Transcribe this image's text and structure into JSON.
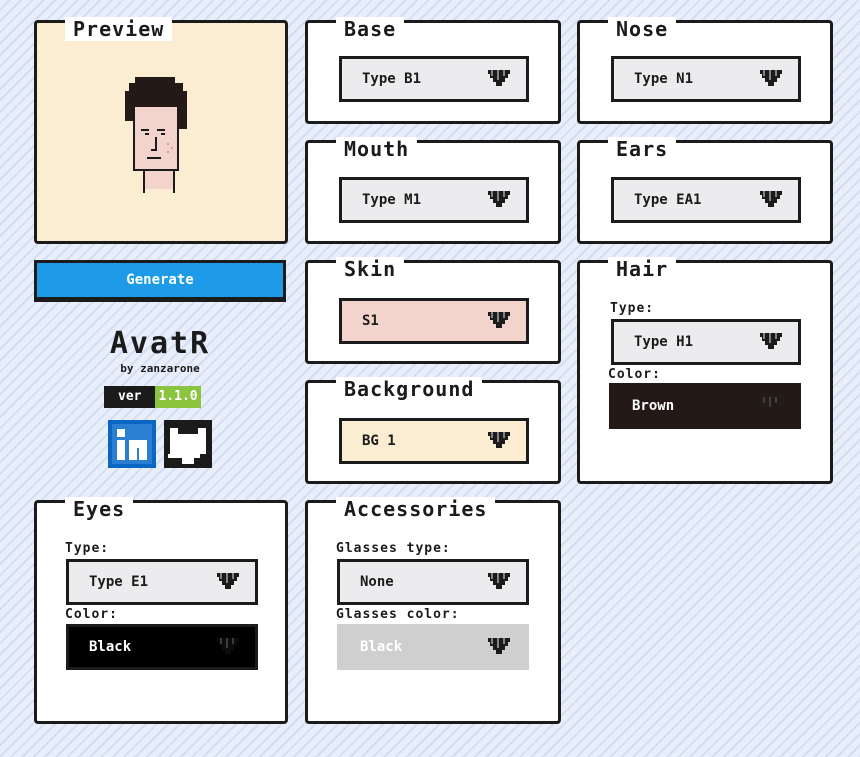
{
  "preview": {
    "title": "Preview"
  },
  "generate": {
    "label": "Generate"
  },
  "brand": {
    "name": "AvatR",
    "by": "by zanzarone",
    "ver_label": "ver",
    "ver_value": "1.1.0"
  },
  "social": {
    "linkedin": "linkedin-icon",
    "github": "github-icon"
  },
  "base": {
    "title": "Base",
    "value": "Type B1"
  },
  "nose": {
    "title": "Nose",
    "value": "Type N1"
  },
  "mouth": {
    "title": "Mouth",
    "value": "Type M1"
  },
  "ears": {
    "title": "Ears",
    "value": "Type EA1"
  },
  "skin": {
    "title": "Skin",
    "value": "S1",
    "color": "#f3d4cd"
  },
  "background": {
    "title": "Background",
    "value": "BG 1",
    "color": "#faedd2"
  },
  "hair": {
    "title": "Hair",
    "type_label": "Type:",
    "type_value": "Type H1",
    "color_label": "Color:",
    "color_value": "Brown",
    "color": "#231a17"
  },
  "eyes": {
    "title": "Eyes",
    "type_label": "Type:",
    "type_value": "Type E1",
    "color_label": "Color:",
    "color_value": "Black",
    "color": "#000000"
  },
  "accessories": {
    "title": "Accessories",
    "glasses_type_label": "Glasses type:",
    "glasses_type_value": "None",
    "glasses_color_label": "Glasses color:",
    "glasses_color_value": "Black"
  }
}
